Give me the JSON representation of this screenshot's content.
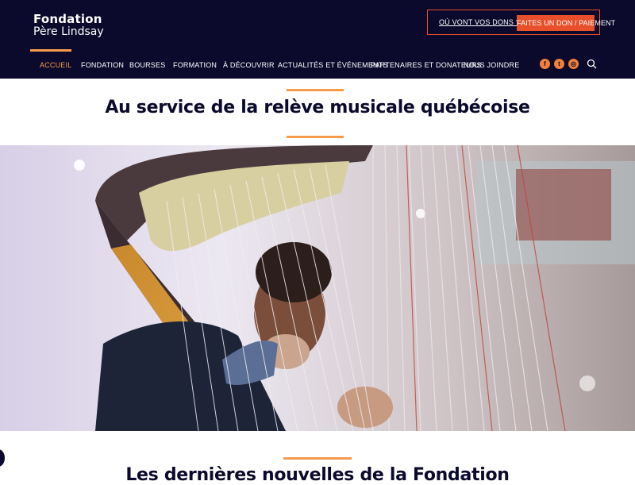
{
  "logo": {
    "line1": "Fondation",
    "line2": "Père Lindsay"
  },
  "donate": {
    "link_label": "OÙ VONT VOS DONS ?",
    "button_label": "FAITES UN DON / PAIEMENT"
  },
  "nav": {
    "items": [
      {
        "label": "ACCUEIL",
        "active": true
      },
      {
        "label": "FONDATION"
      },
      {
        "label": "BOURSES"
      },
      {
        "label": "FORMATION"
      },
      {
        "label": "À DÉCOUVRIR"
      },
      {
        "label": "ACTUALITÉS ET ÉVÉNEMENTS"
      },
      {
        "label": "PARTENAIRES ET DONATEURS"
      },
      {
        "label": "NOUS JOINDRE"
      }
    ]
  },
  "social": [
    {
      "icon": "facebook-icon",
      "glyph": "f"
    },
    {
      "icon": "twitter-icon",
      "glyph": "t"
    },
    {
      "icon": "instagram-icon",
      "glyph": "◎"
    }
  ],
  "main": {
    "title": "Au service de la relève musicale québécoise",
    "news_heading": "Les dernières nouvelles de la Fondation"
  },
  "colors": {
    "header_bg": "#0b0a2c",
    "accent_orange": "#f79a4a",
    "button_red": "#e8502c"
  }
}
